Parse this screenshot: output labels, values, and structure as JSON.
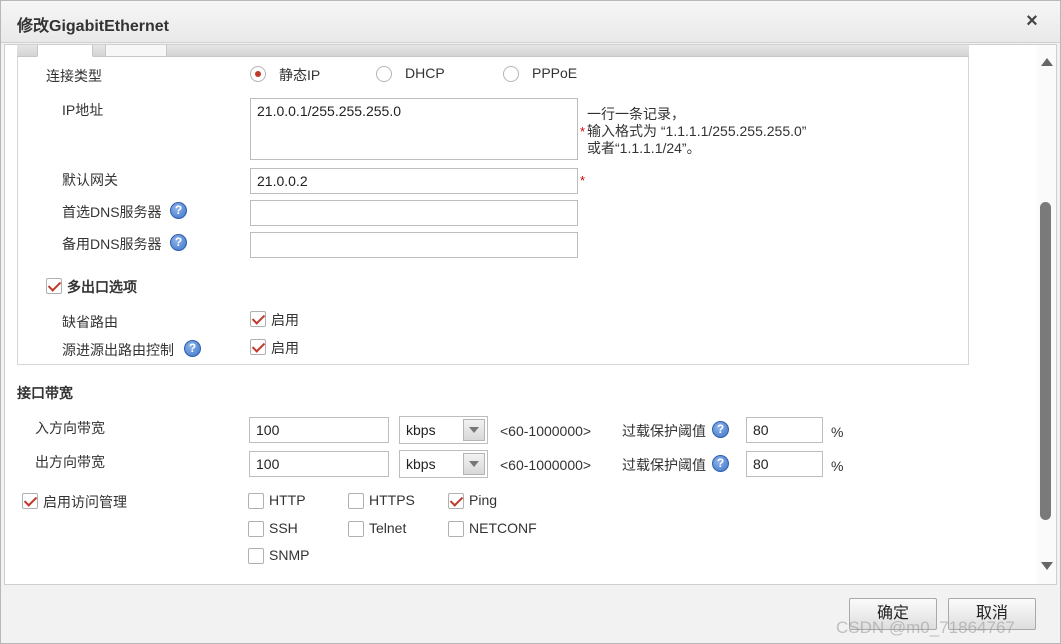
{
  "dialog": {
    "title": "修改GigabitEthernet",
    "close_glyph": "×"
  },
  "tabs": [
    "",
    ""
  ],
  "connection": {
    "label": "连接类型",
    "options": [
      {
        "label": "静态IP",
        "checked": true
      },
      {
        "label": "DHCP",
        "checked": false
      },
      {
        "label": "PPPoE",
        "checked": false
      }
    ]
  },
  "ip": {
    "label": "IP地址",
    "value": "21.0.0.1/255.255.255.0",
    "required_mark": "*",
    "hint_line1": "一行一条记录，",
    "hint_line2": "输入格式为 “1.1.1.1/255.255.255.0”",
    "hint_line3": "或者“1.1.1.1/24”。"
  },
  "gateway": {
    "label": "默认网关",
    "value": "21.0.0.2",
    "required_mark": "*"
  },
  "dns_primary": {
    "label": "首选DNS服务器",
    "value": ""
  },
  "dns_secondary": {
    "label": "备用DNS服务器",
    "value": ""
  },
  "help_glyph": "?",
  "multi_exit": {
    "label": "多出口选项",
    "checked": true,
    "default_route": {
      "label": "缺省路由",
      "option": "启用",
      "checked": true
    },
    "source_route": {
      "label": "源进源出路由控制",
      "option": "启用",
      "checked": true
    }
  },
  "bandwidth": {
    "section_title": "接口带宽",
    "inbound": {
      "label": "入方向带宽",
      "value": "100",
      "unit": "kbps",
      "range": "<60-1000000>",
      "threshold_label": "过载保护阈值",
      "threshold_value": "80",
      "percent": "%"
    },
    "outbound": {
      "label": "出方向带宽",
      "value": "100",
      "unit": "kbps",
      "range": "<60-1000000>",
      "threshold_label": "过载保护阈值",
      "threshold_value": "80",
      "percent": "%"
    }
  },
  "access": {
    "label": "启用访问管理",
    "checked": true,
    "protocols": [
      {
        "label": "HTTP",
        "checked": false
      },
      {
        "label": "HTTPS",
        "checked": false
      },
      {
        "label": "Ping",
        "checked": true
      },
      {
        "label": "SSH",
        "checked": false
      },
      {
        "label": "Telnet",
        "checked": false
      },
      {
        "label": "NETCONF",
        "checked": false
      },
      {
        "label": "SNMP",
        "checked": false
      }
    ]
  },
  "footer": {
    "ok_label": "确定",
    "cancel_label": "取消"
  },
  "watermark": "CSDN @m0_71864767"
}
